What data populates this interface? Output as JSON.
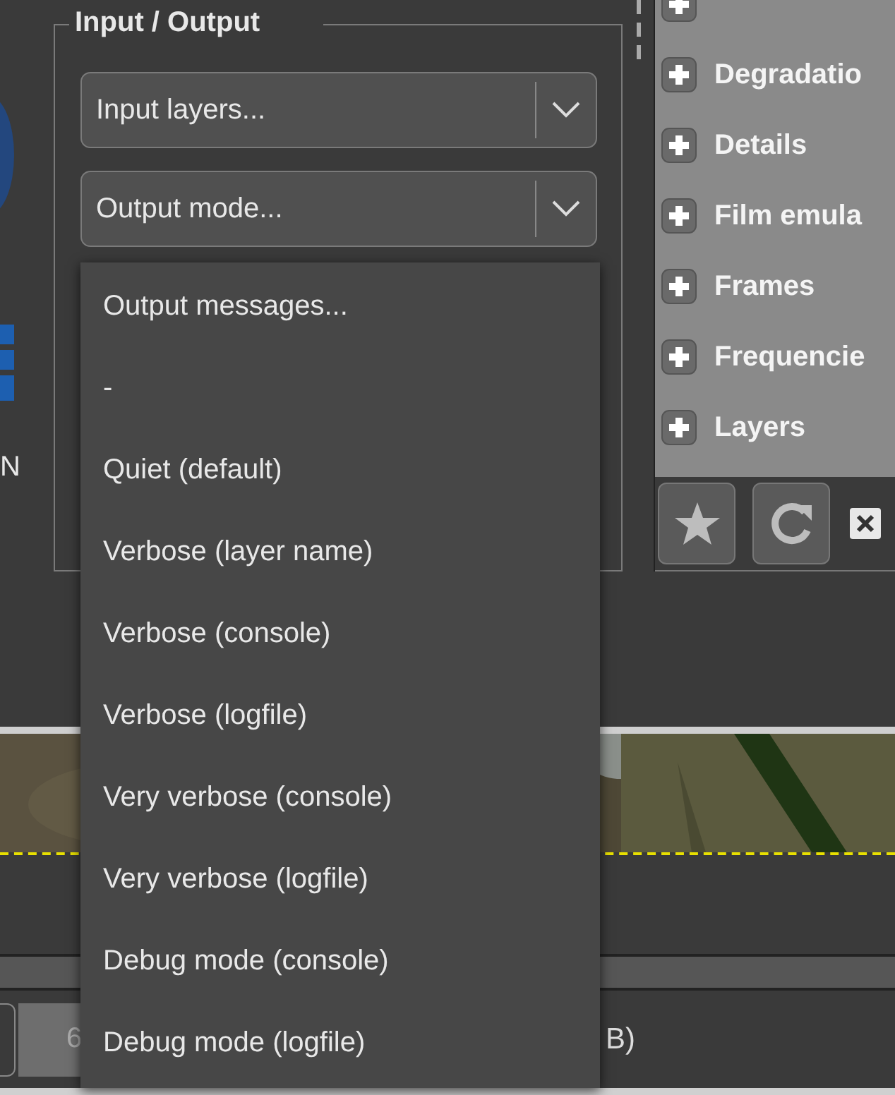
{
  "left_strip": {
    "text": "N"
  },
  "group": {
    "title": "Input / Output",
    "combos": [
      {
        "value": "Input layers..."
      },
      {
        "value": "Output mode..."
      }
    ]
  },
  "filters": {
    "items": [
      {
        "label": "Degradatio"
      },
      {
        "label": "Details"
      },
      {
        "label": "Film emula"
      },
      {
        "label": "Frames"
      },
      {
        "label": "Frequencie"
      },
      {
        "label": "Layers"
      }
    ],
    "toolbar": [
      {
        "kind": "star"
      },
      {
        "kind": "refresh"
      },
      {
        "kind": "close"
      }
    ]
  },
  "status_bar": {
    "fields": [
      "6",
      "B)"
    ]
  },
  "popup": {
    "items": [
      "Output messages...",
      "-",
      "Quiet (default)",
      "Verbose (layer name)",
      "Verbose (console)",
      "Verbose (logfile)",
      "Very verbose (console)",
      "Very verbose (logfile)",
      "Debug mode (console)",
      "Debug mode (logfile)"
    ]
  }
}
